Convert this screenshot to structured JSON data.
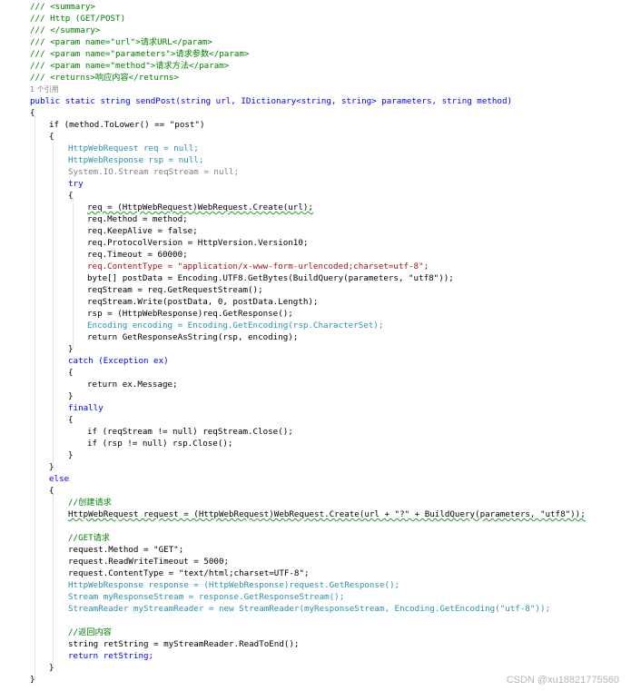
{
  "watermark": "CSDN @xu18821775560",
  "code": {
    "doc_summary_open": "/// <summary>",
    "doc_summary_text": "/// Http (GET/POST)",
    "doc_summary_close": "/// </summary>",
    "doc_param_url": "/// <param name=\"url\">请求URL</param>",
    "doc_param_parameters": "/// <param name=\"parameters\">请求参数</param>",
    "doc_param_method": "/// <param name=\"method\">请求方法</param>",
    "doc_returns": "/// <returns>响应内容</returns>",
    "ref_count": "1 个引用",
    "method_signature": "public static string sendPost(string url, IDictionary<string, string> parameters, string method)",
    "brace_open_0": "{",
    "if_post": "if (method.ToLower() == \"post\")",
    "brace_open_1": "{",
    "decl_req": "HttpWebRequest req = null;",
    "decl_rsp": "HttpWebResponse rsp = null;",
    "decl_stream": "System.IO.Stream reqStream = null;",
    "try_kw": "try",
    "brace_open_2": "{",
    "req_create": "req = (HttpWebRequest)WebRequest.Create(url);",
    "req_method": "req.Method = method;",
    "req_keepalive": "req.KeepAlive = false;",
    "req_protocol": "req.ProtocolVersion = HttpVersion.Version10;",
    "req_timeout": "req.Timeout = 60000;",
    "req_contenttype": "req.ContentType = \"application/x-www-form-urlencoded;charset=utf-8\";",
    "post_data": "byte[] postData = Encoding.UTF8.GetBytes(BuildQuery(parameters, \"utf8\"));",
    "get_stream": "reqStream = req.GetRequestStream();",
    "write_stream": "reqStream.Write(postData, 0, postData.Length);",
    "get_response": "rsp = (HttpWebResponse)req.GetResponse();",
    "encoding_decl": "Encoding encoding = Encoding.GetEncoding(rsp.CharacterSet);",
    "return_as_string": "return GetResponseAsString(rsp, encoding);",
    "brace_close_2": "}",
    "catch_kw": "catch (Exception ex)",
    "brace_open_3": "{",
    "return_msg": "return ex.Message;",
    "brace_close_3": "}",
    "finally_kw": "finally",
    "brace_open_4": "{",
    "close_stream": "if (reqStream != null) reqStream.Close();",
    "close_rsp": "if (rsp != null) rsp.Close();",
    "brace_close_4": "}",
    "brace_close_1": "}",
    "else_kw": "else",
    "brace_open_5": "{",
    "comment_create": "//创建请求",
    "get_req_create": "HttpWebRequest request = (HttpWebRequest)WebRequest.Create(url + \"?\" + BuildQuery(parameters, \"utf8\"));",
    "comment_get": "//GET请求",
    "request_method": "request.Method = \"GET\";",
    "request_rwtimeout": "request.ReadWriteTimeout = 5000;",
    "request_contenttype": "request.ContentType = \"text/html;charset=UTF-8\";",
    "response_decl": "HttpWebResponse response = (HttpWebResponse)request.GetResponse();",
    "response_stream": "Stream myResponseStream = response.GetResponseStream();",
    "stream_reader": "StreamReader myStreamReader = new StreamReader(myResponseStream, Encoding.GetEncoding(\"utf-8\"));",
    "comment_return": "//返回内容",
    "ret_string": "string retString = myStreamReader.ReadToEnd();",
    "return_ret": "return retString;",
    "brace_close_5": "}",
    "brace_close_0": "}"
  },
  "colors": {
    "keyword": "#0000ff",
    "type": "#2b91af",
    "string": "#a31515",
    "comment": "#008000",
    "gray": "#7f7f7f"
  }
}
